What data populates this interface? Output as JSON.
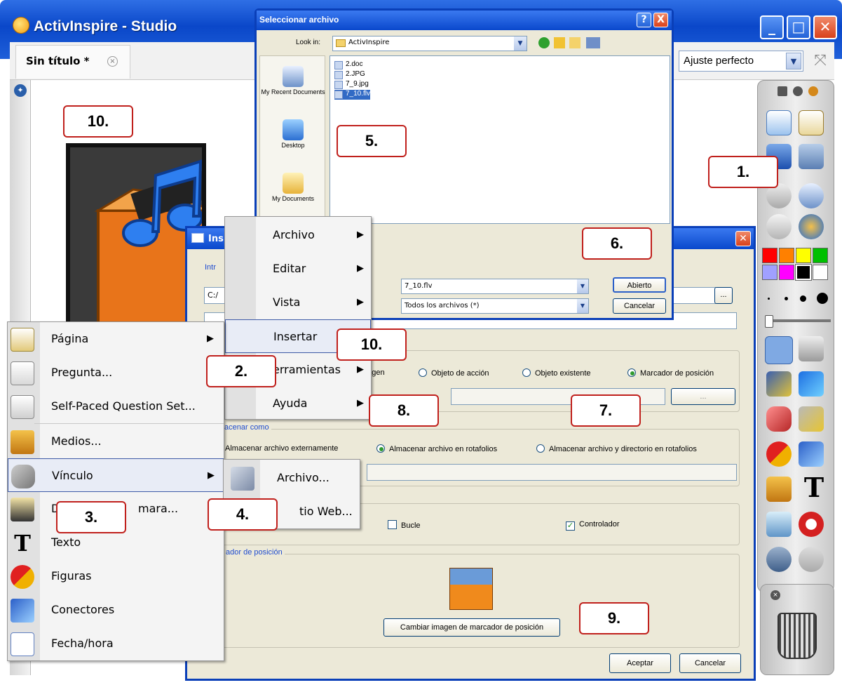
{
  "window": {
    "title": "ActivInspire - Studio",
    "controls": {
      "minimize": "_",
      "maximize": "□",
      "close": "✕"
    }
  },
  "tab": {
    "label": "Sin título *",
    "close": "×"
  },
  "zoom": {
    "selected": "Ajuste perfecto"
  },
  "file_dialog": {
    "title": "Seleccionar archivo",
    "help": "?",
    "close": "X",
    "lookin_label": "Look in:",
    "lookin_value": "ActivInspire",
    "places": [
      "My Recent Documents",
      "Desktop",
      "My Documents"
    ],
    "files": [
      "2.doc",
      "2.JPG",
      "7_9.jpg",
      "7_10.flv"
    ],
    "selected_file": "7_10.flv",
    "filename_value": "7_10.flv",
    "filetype_value": "Todos los archivos (*)",
    "open_button": "Abierto",
    "cancel_button": "Cancelar"
  },
  "insert_dialog": {
    "title": "Ins",
    "intro_label": "Intr",
    "path_value": "C:/",
    "browse": "...",
    "radios_use": [
      {
        "label": "magen",
        "checked": false
      },
      {
        "label": "Objeto de acción",
        "checked": false
      },
      {
        "label": "Objeto existente",
        "checked": false
      },
      {
        "label": "Marcador de posición",
        "checked": true
      }
    ],
    "placeholder_browse": "...",
    "store_group_label": "acenar como",
    "radios_store": [
      {
        "label": "Almacenar archivo externamente",
        "checked": false
      },
      {
        "label": "Almacenar archivo en rotafolios",
        "checked": true
      },
      {
        "label": "Almacenar archivo y directorio en rotafolios",
        "checked": false
      }
    ],
    "loop_label": "Bucle",
    "controller_label": "Controlador",
    "placeholder_group_label": "ador de posición",
    "change_image_button": "Cambiar imagen de marcador de posición",
    "accept_button": "Aceptar",
    "cancel_button": "Cancelar"
  },
  "main_menu": {
    "items": [
      "Archivo",
      "Editar",
      "Vista",
      "Insertar",
      "erramientas",
      "Ayuda"
    ],
    "highlighted": "Insertar"
  },
  "insert_menu": {
    "items": [
      {
        "label": "Página",
        "submenu": true
      },
      {
        "label": "Pregunta...",
        "submenu": false
      },
      {
        "label": "Self-Paced Question Set...",
        "submenu": false
      },
      {
        "label": "Medios...",
        "submenu": false
      },
      {
        "label": "Vínculo",
        "submenu": true
      },
      {
        "label": "D",
        "suffix": "mara...",
        "submenu": false
      },
      {
        "label": "Texto",
        "submenu": false
      },
      {
        "label": "Figuras",
        "submenu": false
      },
      {
        "label": "Conectores",
        "submenu": false
      },
      {
        "label": "Fecha/hora",
        "submenu": false
      }
    ],
    "highlighted": "Vínculo"
  },
  "link_submenu": {
    "items": [
      "Archivo...",
      "tio Web..."
    ]
  },
  "callouts": {
    "c1": "1.",
    "c2": "2.",
    "c3": "3.",
    "c4": "4.",
    "c5": "5.",
    "c6": "6.",
    "c7": "7.",
    "c8": "8.",
    "c9": "9.",
    "c10a": "10.",
    "c10b": "10."
  },
  "palette_colors": [
    "#ff0000",
    "#ff8000",
    "#ffff00",
    "#00c000",
    "#a0a0ff",
    "#ff00ff",
    "#000000",
    "#ffffff"
  ],
  "accent": {
    "titlebar": "#0a48cc",
    "callout_border": "#c0201c"
  }
}
